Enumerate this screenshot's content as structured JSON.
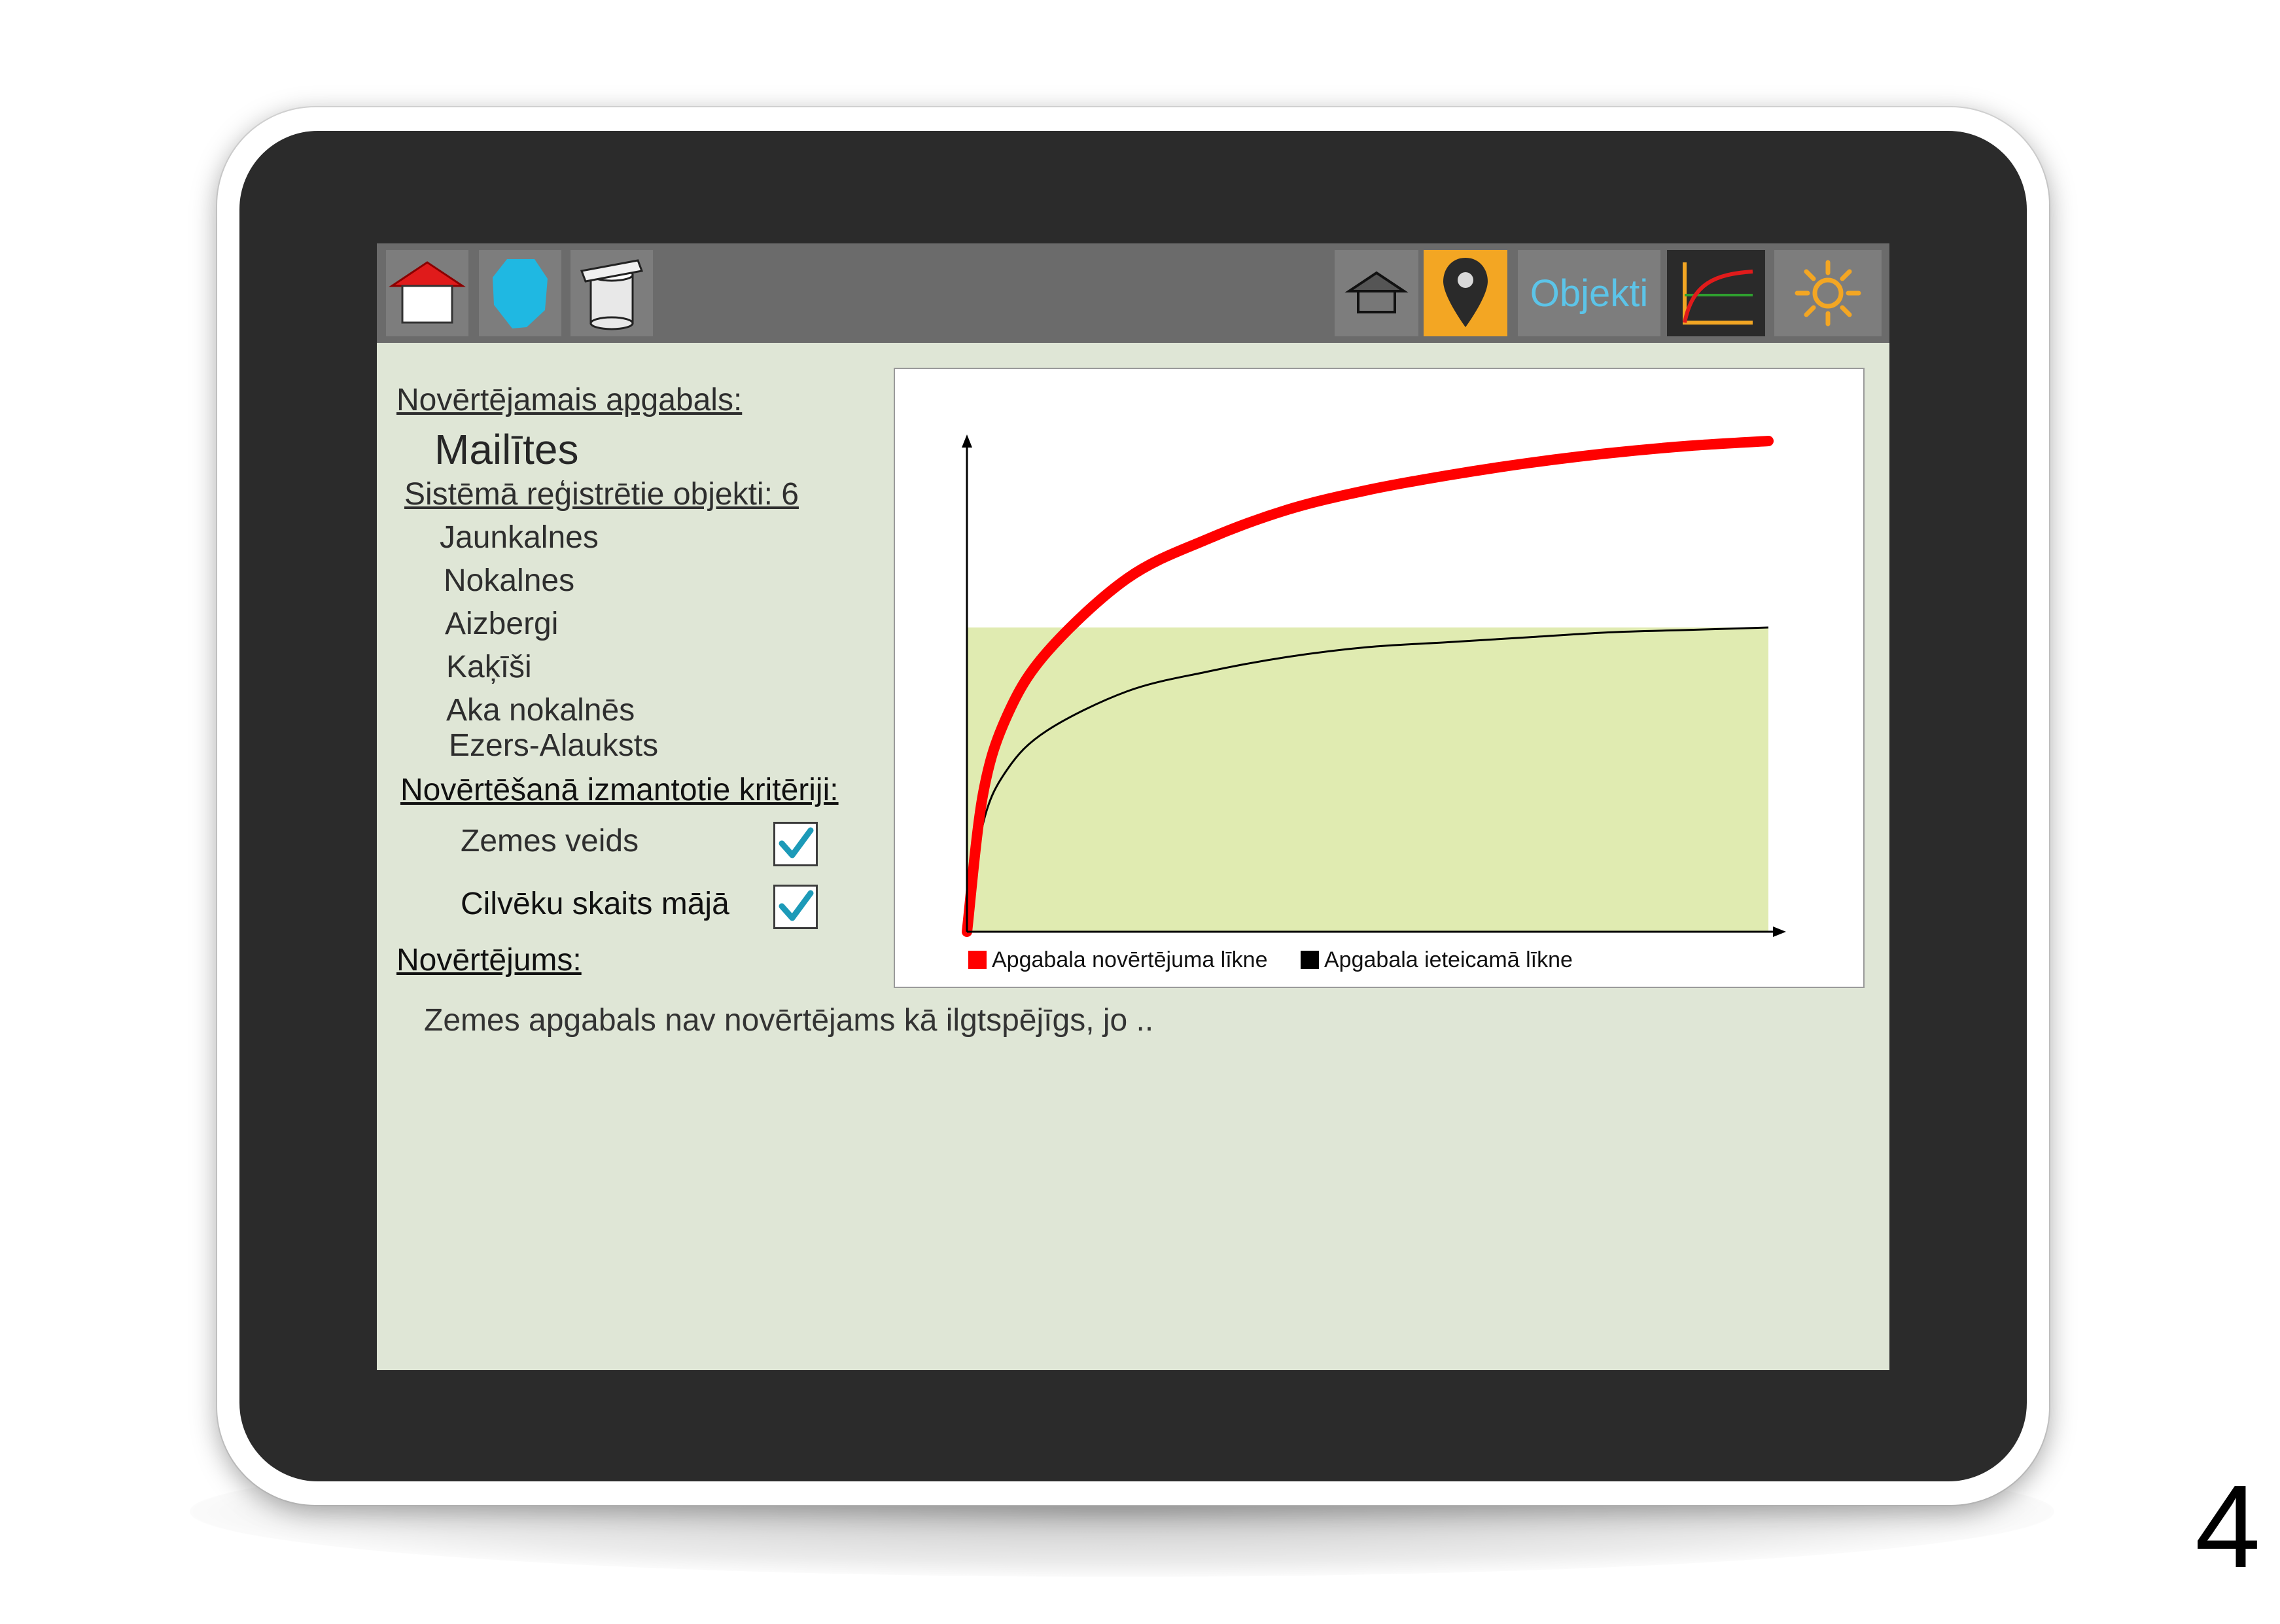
{
  "toolbar": {
    "left_icons": [
      "home-red-roof-icon",
      "blue-area-icon",
      "database-icon"
    ],
    "right_icons": [
      "house-icon",
      "map-pin-icon",
      "chart-icon",
      "sun-icon"
    ],
    "objekti_label": "Objekti",
    "active_item": "map-pin",
    "accent_color": "#f3a623"
  },
  "region": {
    "label": "Novērtējamais apgabals:",
    "name": "Mailītes"
  },
  "objects": {
    "label": "Sistēmā reģistrētie objekti: 6",
    "items": [
      "Jaunkalnes",
      "Nokalnes",
      "Aizbergi",
      "Kaķīši",
      "Aka nokalnēs",
      "Ezers-Alauksts"
    ]
  },
  "criteria": {
    "label": "Novērtēšanā izmantotie kritēriji:",
    "items": [
      {
        "label": "Zemes veids",
        "checked": true
      },
      {
        "label": "Cilvēku skaits mājā",
        "checked": true
      }
    ]
  },
  "assessment": {
    "label": "Novērtējums:",
    "text": "Zemes apgabals nav novērtējams kā ilgtspējīgs, jo .."
  },
  "chart_data": {
    "type": "line",
    "title": "",
    "xlabel": "",
    "ylabel": "",
    "x": [
      0,
      0.02,
      0.05,
      0.1,
      0.2,
      0.3,
      0.4,
      0.5,
      0.6,
      0.7,
      0.8,
      0.9,
      1.0
    ],
    "series": [
      {
        "name": "Apgabala novērtējuma līkne",
        "color": "#ff0000",
        "values": [
          0,
          0.28,
          0.44,
          0.57,
          0.72,
          0.8,
          0.86,
          0.9,
          0.93,
          0.955,
          0.975,
          0.99,
          1.0
        ]
      },
      {
        "name": "Apgabala ieteicamā līkne",
        "color": "#000000",
        "values": [
          0,
          0.22,
          0.33,
          0.41,
          0.49,
          0.53,
          0.56,
          0.58,
          0.59,
          0.6,
          0.61,
          0.615,
          0.62
        ]
      }
    ],
    "fill_band_color": "#e0ebb1",
    "grid": false,
    "legend_position": "bottom"
  },
  "page_number": "4"
}
